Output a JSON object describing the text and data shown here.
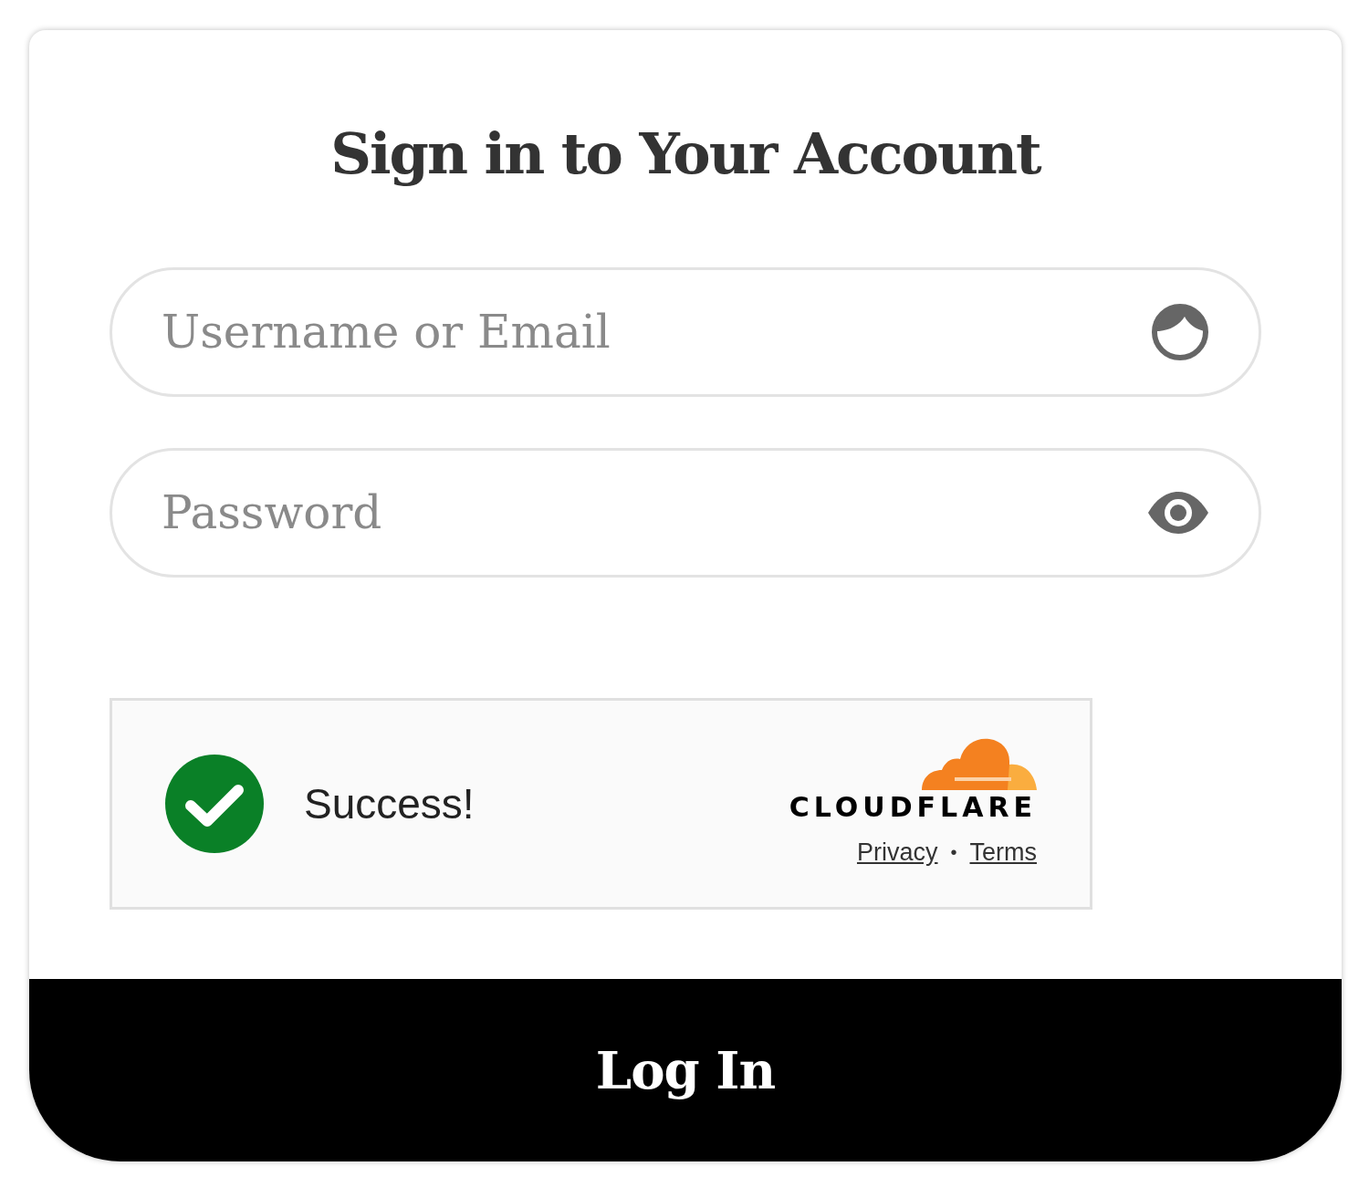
{
  "title": "Sign in to Your Account",
  "fields": [
    {
      "kind": "user",
      "placeholder": "Username or Email"
    },
    {
      "kind": "password",
      "placeholder": "Password"
    }
  ],
  "captcha": {
    "status": "Success!",
    "brand": "CLOUDFLARE",
    "links": [
      "Privacy",
      "Terms"
    ],
    "separator": "•"
  },
  "submit": "Log In"
}
